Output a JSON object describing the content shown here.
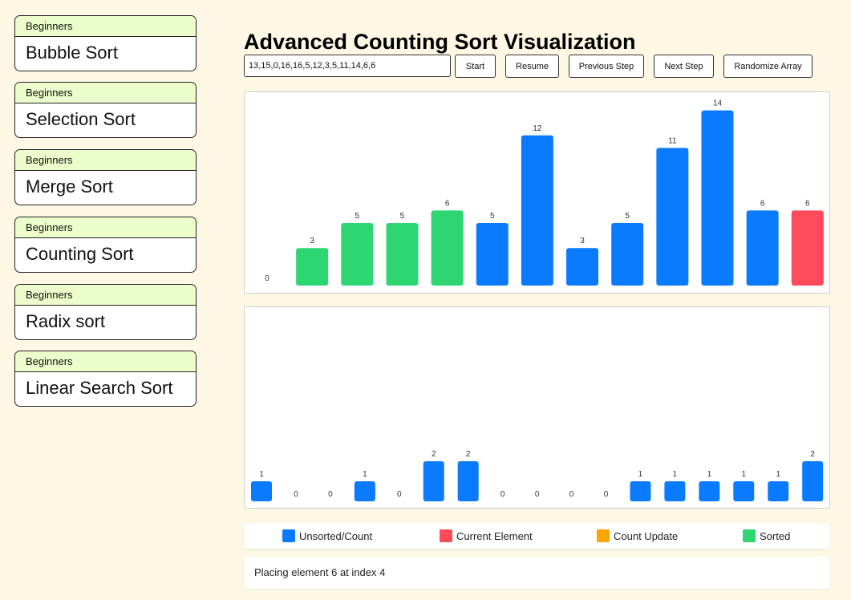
{
  "sidebar": {
    "items": [
      {
        "tag": "Beginners",
        "name": "Bubble Sort"
      },
      {
        "tag": "Beginners",
        "name": "Selection Sort"
      },
      {
        "tag": "Beginners",
        "name": "Merge Sort"
      },
      {
        "tag": "Beginners",
        "name": "Counting Sort"
      },
      {
        "tag": "Beginners",
        "name": "Radix sort"
      },
      {
        "tag": "Beginners",
        "name": "Linear Search Sort"
      }
    ]
  },
  "header": {
    "title": "Advanced Counting Sort Visualization",
    "array_input_value": "13,15,0,16,16,5,12,3,5,11,14,6,6"
  },
  "toolbar": {
    "start": "Start",
    "resume": "Resume",
    "previous": "Previous Step",
    "next": "Next Step",
    "randomize": "Randomize Array"
  },
  "colors": {
    "unsorted": "#0a7bff",
    "current": "#ff4a5a",
    "count_update": "#ffa500",
    "sorted": "#2ed573"
  },
  "chart_data": [
    {
      "type": "bar",
      "values": [
        0,
        3,
        5,
        5,
        6,
        5,
        12,
        3,
        5,
        11,
        14,
        6,
        6
      ],
      "states": [
        "sorted",
        "sorted",
        "sorted",
        "sorted",
        "sorted",
        "unsorted",
        "unsorted",
        "unsorted",
        "unsorted",
        "unsorted",
        "unsorted",
        "unsorted",
        "current"
      ],
      "data_labels": true
    },
    {
      "type": "bar",
      "values": [
        1,
        0,
        0,
        1,
        0,
        2,
        2,
        0,
        0,
        0,
        0,
        1,
        1,
        1,
        1,
        1,
        2
      ],
      "data_labels": true
    }
  ],
  "legend": [
    {
      "label": "Unsorted/Count",
      "color": "#0a7bff"
    },
    {
      "label": "Current Element",
      "color": "#ff4a5a"
    },
    {
      "label": "Count Update",
      "color": "#ffa500"
    },
    {
      "label": "Sorted",
      "color": "#2ed573"
    }
  ],
  "status": {
    "message": "Placing element 6 at index 4"
  }
}
